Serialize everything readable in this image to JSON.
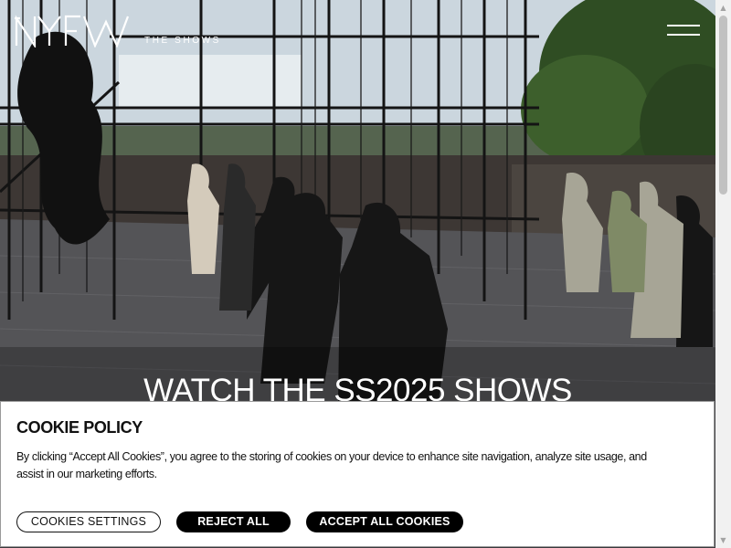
{
  "header": {
    "logo_text": "NYFW",
    "logo_subtitle": "THE SHOWS",
    "menu_icon": "hamburger-menu-icon"
  },
  "hero": {
    "title": "WATCH THE SS2025 SHOWS",
    "image": "runway-show-photo"
  },
  "cookie_banner": {
    "title": "COOKIE POLICY",
    "text": "By clicking “Accept All Cookies”, you agree to the storing of cookies on your device to enhance site navigation, analyze site usage, and assist in our marketing efforts.",
    "buttons": {
      "settings": "COOKIES SETTINGS",
      "reject": "REJECT ALL",
      "accept": "ACCEPT ALL COOKIES"
    }
  },
  "scrollbar": {
    "up_icon": "scroll-up-arrow-icon",
    "down_icon": "scroll-down-arrow-icon"
  },
  "colors": {
    "banner_bg": "#ffffff",
    "button_dark": "#000000",
    "text": "#111111",
    "header_text": "#ffffff"
  }
}
